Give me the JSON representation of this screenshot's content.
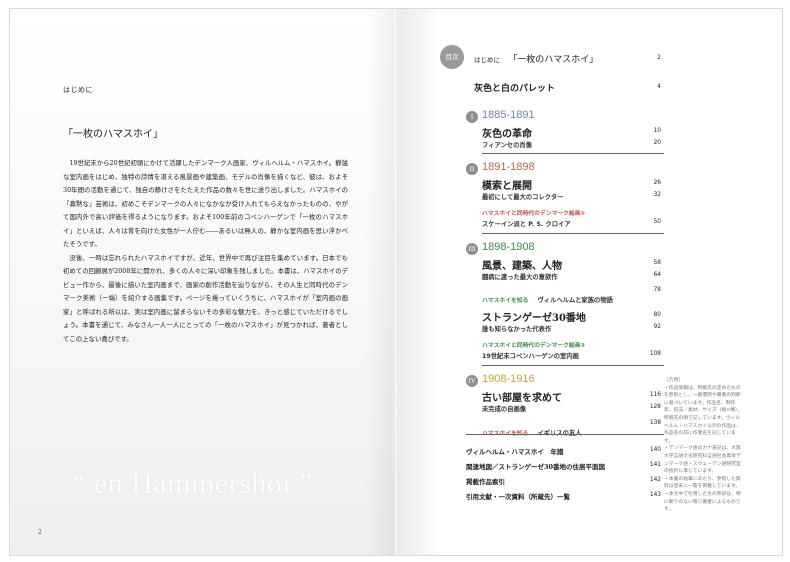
{
  "left_page": {
    "heading": "はじめに",
    "lead_title": "「一枚のハマスホイ」",
    "paragraphs": [
      "19世紀末から20世紀初頭にかけて活躍したデンマーク人画家、ヴィルヘルム・ハマスホイ。静謐な室内画をはじめ、独特の詩情を湛える風景画や建築画、モデルの肖像を描くなど、彼は、およそ30年間の活動を通じて、独自の静けさをたたえた作品の数々を世に送り出しました。ハマスホイの「寡黙な」芸術は、初めこそデンマークの人々になかなか受け入れてもらえなかったものの、やがて国内外で高い評価を得るようになります。およそ100年前のコペンハーゲンで「一枚のハマスホイ」といえば、人々は背を向けた女性が一人佇む――あるいは無人の、静かな室内画を思い浮かべたそうです。",
      "没後、一時は忘れられたハマスホイですが、近年、世界中で再び注目を集めています。日本でも初めての回顧展が2008年に開かれ、多くの人々に深い印象を残しました。本書は、ハマスホイのデビュー作から、最後に描いた室内画まで、画家の創作活動を辿りながら、その人生と同時代のデンマーク美術（一端）を紹介する画集です。ページを捲っていくうちに、ハマスホイが「室内画の画家」と呼ばれる所以は、実は室内画に留まらないその多彩な魅力を、きっと感じていただけるでしょう。本書を通じて、みなさん一人一人にとっての「一枚のハマスホイ」が見つかれば、著者としてこの上ない喜びです。"
    ],
    "quote": "“ en Hammershøi ”",
    "page_number": "2"
  },
  "toc": {
    "badge": "目次",
    "intro": {
      "label": "はじめに",
      "title": "「一枚のハマスホイ」",
      "page": "2"
    },
    "palette": {
      "title": "灰色と白のパレット",
      "page": "4"
    },
    "sections": [
      {
        "numeral": "I",
        "era": "1885-1891",
        "era_color": "#6f7fb8",
        "chapter": "灰色の革命",
        "chapter_page": "10",
        "items": [
          {
            "kind": "sub",
            "text": "フィアンセの肖像",
            "page": "20"
          }
        ]
      },
      {
        "numeral": "II",
        "era": "1891-1898",
        "era_color": "#c0634e",
        "chapter": "模索と展開",
        "chapter_page": "26",
        "items": [
          {
            "kind": "sub",
            "text": "最初にして最大のコレクター",
            "page": "32"
          },
          {
            "kind": "red",
            "text": "ハマスホイと同時代のデンマーク絵画①",
            "page": ""
          },
          {
            "kind": "sub",
            "text": "スケーイン派と P. S. クロイア",
            "page": "50"
          }
        ]
      },
      {
        "numeral": "III",
        "era": "1898-1908",
        "era_color": "#3f8a4e",
        "chapter": "風景、建築、人物",
        "chapter_page": "58",
        "items": [
          {
            "kind": "sub",
            "text": "闘病に渡った最大の意欲作",
            "page": "64"
          },
          {
            "kind": "green_combo",
            "tag": "ハマスホイを知る",
            "text": "ヴィルヘルムと家族の物語",
            "page": "78"
          }
        ],
        "chapter2": "ストランゲーゼ30番地",
        "chapter2_page": "80",
        "items2": [
          {
            "kind": "sub",
            "text": "誰も知らなかった代表作",
            "page": "92"
          },
          {
            "kind": "green",
            "text": "ハマスホイと同時代のデンマーク絵画②",
            "page": ""
          },
          {
            "kind": "sub",
            "text": "19世紀末コペンハーゲンの室内画",
            "page": "108"
          }
        ]
      },
      {
        "numeral": "IV",
        "era": "1908-1916",
        "era_color": "#c9a23a",
        "chapter": "古い部屋を求めて",
        "chapter_page": "116",
        "items": [
          {
            "kind": "sub",
            "text": "未完成の自画像",
            "page": "128"
          },
          {
            "kind": "red_combo",
            "tag": "ハマスホイを知る",
            "text": "イギリスの友人",
            "page": "138"
          }
        ]
      }
    ],
    "back_matter": [
      {
        "title": "ヴィルヘルム・ハマスホイ　年譜",
        "page": "140"
      },
      {
        "title": "関連地図／ストランゲーゼ30番地の住居平面図",
        "page": "141"
      },
      {
        "title": "掲載作品索引",
        "page": "142"
      },
      {
        "title": "引用文献・一次資料（所蔵先）一覧",
        "page": "143"
      }
    ],
    "notes": [
      "［凡例］",
      "・作品情報は、所蔵先の定めたものを原則とし、一部慣例や著者の判断に基づいています。作品名、制作年、技法／素材、サイズ（縦×横）、所蔵先の順で記しています。ヴィルヘルム・ハマスホイ以外の作品は、作品名の前に作者名を記しています。",
      "・デンマーク語のカナ表記は、大阪大学言語文化研究科言語社会専攻デンマーク語・スウェーデン語研究室の指針に準じています。",
      "・本書の執筆にあたり、参照した資料は巻末に一覧を掲載しています。",
      "・本文中で引用した文の邦訳は、特に断りのない限り著者によるものです。"
    ]
  }
}
